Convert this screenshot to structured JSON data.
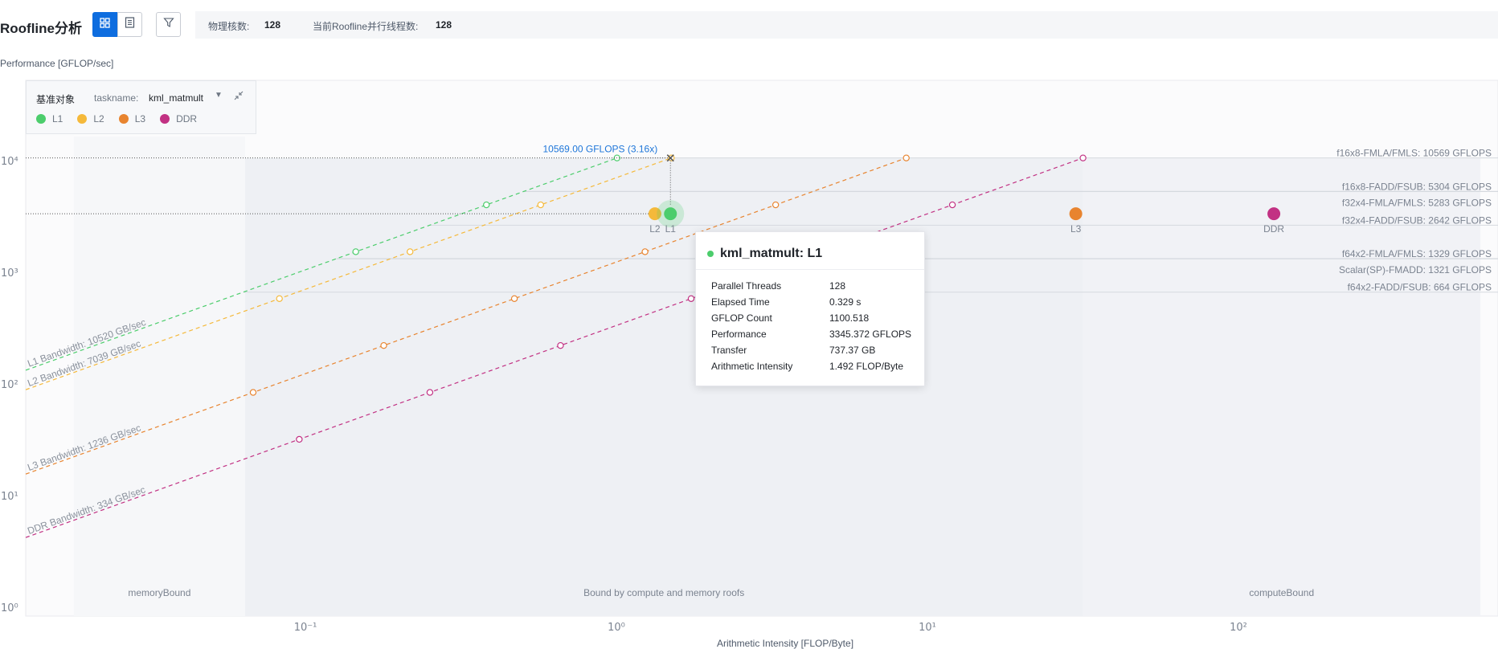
{
  "header": {
    "title": "Roofline分析",
    "cores_label": "物理核数:",
    "cores_value": "128",
    "threads_label": "当前Roofline并行线程数:",
    "threads_value": "128"
  },
  "legend_panel": {
    "label": "基准对象",
    "taskname_label": "taskname:",
    "taskname_value": "kml_matmult",
    "items": [
      {
        "name": "L1",
        "color": "#4ccd6c"
      },
      {
        "name": "L2",
        "color": "#f5b93a"
      },
      {
        "name": "L3",
        "color": "#e8842f"
      },
      {
        "name": "DDR",
        "color": "#c23183"
      }
    ]
  },
  "tooltip": {
    "title": "kml_matmult: L1",
    "rows": [
      {
        "k": "Parallel Threads",
        "v": "128"
      },
      {
        "k": "Elapsed Time",
        "v": "0.329 s"
      },
      {
        "k": "GFLOP Count",
        "v": "1100.518"
      },
      {
        "k": "Performance",
        "v": "3345.372 GFLOPS"
      },
      {
        "k": "Transfer",
        "v": "737.37 GB"
      },
      {
        "k": "Arithmetic Intensity",
        "v": "1.492 FLOP/Byte"
      }
    ]
  },
  "chart_data": {
    "type": "scatter",
    "ylabel": "Performance [GFLOP/sec]",
    "xlabel": "Arithmetic Intensity [FLOP/Byte]",
    "x_scale": "log",
    "y_scale": "log",
    "xlim": [
      0.018,
      600
    ],
    "ylim": [
      1,
      30000
    ],
    "x_ticks": [
      {
        "v": 0.1,
        "label": "10⁻¹"
      },
      {
        "v": 1,
        "label": "10⁰"
      },
      {
        "v": 10,
        "label": "10¹"
      },
      {
        "v": 100,
        "label": "10²"
      }
    ],
    "y_ticks": [
      {
        "v": 1,
        "label": "10⁰"
      },
      {
        "v": 10,
        "label": "10¹"
      },
      {
        "v": 100,
        "label": "10²"
      },
      {
        "v": 1000,
        "label": "10³"
      },
      {
        "v": 10000,
        "label": "10⁴"
      }
    ],
    "bandwidths": [
      {
        "name": "L1",
        "label": "L1 Bandwidth: 10520 GB/sec",
        "gbps": 10520,
        "color": "#4ccd6c"
      },
      {
        "name": "L2",
        "label": "L2 Bandwidth: 7039 GB/sec",
        "gbps": 7039,
        "color": "#f5b93a"
      },
      {
        "name": "L3",
        "label": "L3 Bandwidth: 1236 GB/sec",
        "gbps": 1236,
        "color": "#e8842f"
      },
      {
        "name": "DDR",
        "label": "DDR Bandwidth: 334 GB/sec",
        "gbps": 334,
        "color": "#c23183"
      }
    ],
    "compute_roofs": [
      {
        "label": "f16x8-FMLA/FMLS: 10569 GFLOPS",
        "gflops": 10569
      },
      {
        "label": "f16x8-FADD/FSUB: 5304 GFLOPS",
        "gflops": 5304
      },
      {
        "label": "f32x4-FMLA/FMLS: 5283 GFLOPS",
        "gflops": 5283
      },
      {
        "label": "f32x4-FADD/FSUB: 2642 GFLOPS",
        "gflops": 2642
      },
      {
        "label": "f64x2-FMLA/FMLS: 1329 GFLOPS",
        "gflops": 1329
      },
      {
        "label": "Scalar(SP)-FMADD: 1321 GFLOPS",
        "gflops": 1321
      },
      {
        "label": "f64x2-FADD/FSUB: 664 GFLOPS",
        "gflops": 664
      }
    ],
    "points": [
      {
        "name": "L2",
        "x": 1.33,
        "y": 3345,
        "color": "#f5b93a"
      },
      {
        "name": "L1",
        "x": 1.492,
        "y": 3345,
        "color": "#4ccd6c"
      },
      {
        "name": "L3",
        "x": 30,
        "y": 3345,
        "color": "#e8842f"
      },
      {
        "name": "DDR",
        "x": 130,
        "y": 3345,
        "color": "#c23183"
      }
    ],
    "peak_annotation": {
      "label": "10569.00 GFLOPS (3.16x)",
      "x": 1.492,
      "y": 10569
    },
    "regions": [
      {
        "label": "memoryBound",
        "from": 0.018,
        "to": 0.064
      },
      {
        "label": "Bound by compute and memory roofs",
        "from": 0.064,
        "to": 31.6
      },
      {
        "label": "computeBound",
        "from": 31.6,
        "to": 600
      }
    ]
  }
}
